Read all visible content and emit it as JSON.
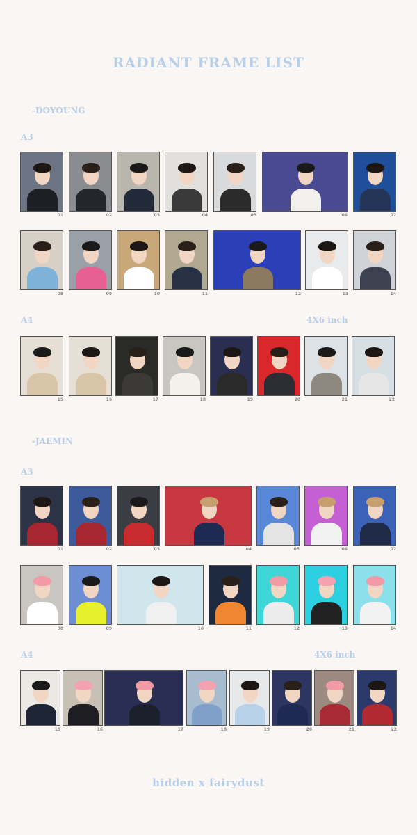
{
  "title": "RADIANT FRAME LIST",
  "footer": "hidden x fairydust",
  "sections": [
    {
      "member": "-DOYOUNG",
      "a3_label": "A3",
      "a4_label": "A4",
      "inch_label": "4X6 inch",
      "row1": [
        "01",
        "02",
        "03",
        "04",
        "05",
        "06",
        "07"
      ],
      "row2": [
        "08",
        "09",
        "10",
        "11",
        "12",
        "13",
        "14"
      ],
      "row3": [
        "15",
        "16",
        "17",
        "18",
        "19",
        "20",
        "21",
        "22"
      ]
    },
    {
      "member": "-JAEMIN",
      "a3_label": "A3",
      "a4_label": "A4",
      "inch_label": "4X6 inch",
      "row1": [
        "01",
        "02",
        "03",
        "04",
        "05",
        "06",
        "07"
      ],
      "row2": [
        "08",
        "09",
        "10",
        "11",
        "12",
        "13",
        "14"
      ],
      "row3": [
        "15",
        "16",
        "17",
        "18",
        "19",
        "20",
        "21",
        "22"
      ]
    }
  ],
  "colors": {
    "background": "#faf6f3",
    "accent": "#b8cfe8"
  }
}
